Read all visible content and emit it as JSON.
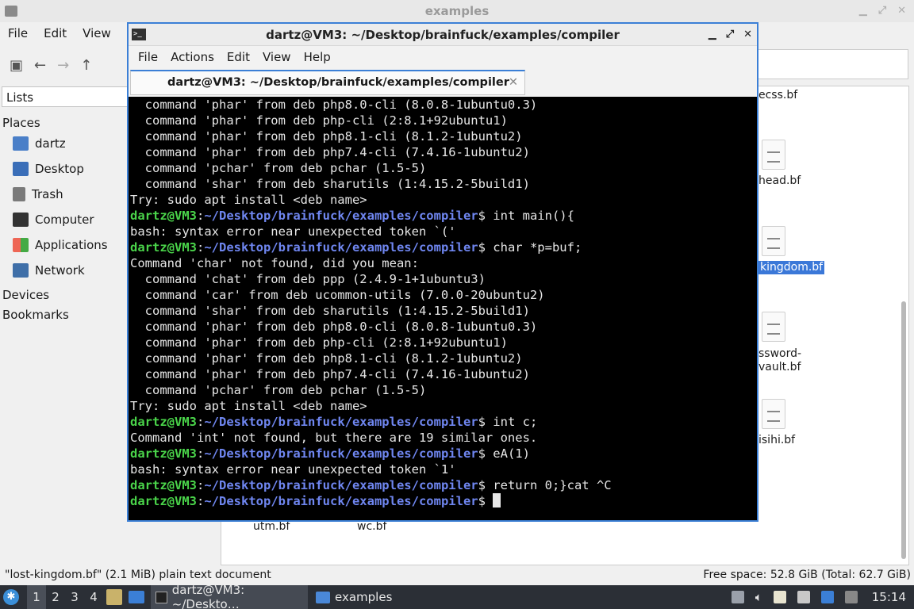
{
  "file_manager": {
    "title": "examples",
    "menu": [
      "File",
      "Edit",
      "View"
    ],
    "lists_label": "Lists",
    "places_label": "Places",
    "places": [
      "dartz",
      "Desktop",
      "Trash",
      "Computer",
      "Applications",
      "Network"
    ],
    "devices_label": "Devices",
    "bookmarks_label": "Bookmarks",
    "files": {
      "f1": "ecss.bf",
      "f2": "head.bf",
      "f3": "kingdom.bf",
      "f4a": "ssword-",
      "f4b": "vault.bf",
      "f5": "isihi.bf",
      "f6": "utm.bf",
      "f7": "wc.bf"
    },
    "status_left": "\"lost-kingdom.bf\" (2.1 MiB) plain text document",
    "status_right": "Free space: 52.8 GiB (Total: 62.7 GiB)"
  },
  "terminal": {
    "title": "dartz@VM3: ~/Desktop/brainfuck/examples/compiler",
    "menu": [
      "File",
      "Actions",
      "Edit",
      "View",
      "Help"
    ],
    "tab_label": "dartz@VM3: ~/Desktop/brainfuck/examples/compiler",
    "prompt_user": "dartz@VM3",
    "prompt_path": "~/Desktop/brainfuck/examples/compiler",
    "lines": [
      {
        "t": "  command 'phar' from deb php8.0-cli (8.0.8-1ubuntu0.3)"
      },
      {
        "t": "  command 'phar' from deb php-cli (2:8.1+92ubuntu1)"
      },
      {
        "t": "  command 'phar' from deb php8.1-cli (8.1.2-1ubuntu2)"
      },
      {
        "t": "  command 'phar' from deb php7.4-cli (7.4.16-1ubuntu2)"
      },
      {
        "t": "  command 'pchar' from deb pchar (1.5-5)"
      },
      {
        "t": "  command 'shar' from deb sharutils (1:4.15.2-5build1)"
      },
      {
        "t": "Try: sudo apt install <deb name>"
      },
      {
        "p": true,
        "c": " int main(){"
      },
      {
        "t": "bash: syntax error near unexpected token `('"
      },
      {
        "p": true,
        "c": " char *p=buf;"
      },
      {
        "t": "Command 'char' not found, did you mean:"
      },
      {
        "t": "  command 'chat' from deb ppp (2.4.9-1+1ubuntu3)"
      },
      {
        "t": "  command 'car' from deb ucommon-utils (7.0.0-20ubuntu2)"
      },
      {
        "t": "  command 'shar' from deb sharutils (1:4.15.2-5build1)"
      },
      {
        "t": "  command 'phar' from deb php8.0-cli (8.0.8-1ubuntu0.3)"
      },
      {
        "t": "  command 'phar' from deb php-cli (2:8.1+92ubuntu1)"
      },
      {
        "t": "  command 'phar' from deb php8.1-cli (8.1.2-1ubuntu2)"
      },
      {
        "t": "  command 'phar' from deb php7.4-cli (7.4.16-1ubuntu2)"
      },
      {
        "t": "  command 'pchar' from deb pchar (1.5-5)"
      },
      {
        "t": "Try: sudo apt install <deb name>"
      },
      {
        "p": true,
        "c": " int c;"
      },
      {
        "t": "Command 'int' not found, but there are 19 similar ones."
      },
      {
        "p": true,
        "c": " eA(1)"
      },
      {
        "t": "bash: syntax error near unexpected token `1'"
      },
      {
        "p": true,
        "c": " return 0;}cat ^C"
      },
      {
        "p": true,
        "c": " ",
        "cursor": true
      }
    ]
  },
  "taskbar": {
    "workspaces": [
      "1",
      "2",
      "3",
      "4"
    ],
    "tasks": [
      "dartz@VM3: ~/Deskto…",
      "examples"
    ],
    "clock": "15:14"
  }
}
